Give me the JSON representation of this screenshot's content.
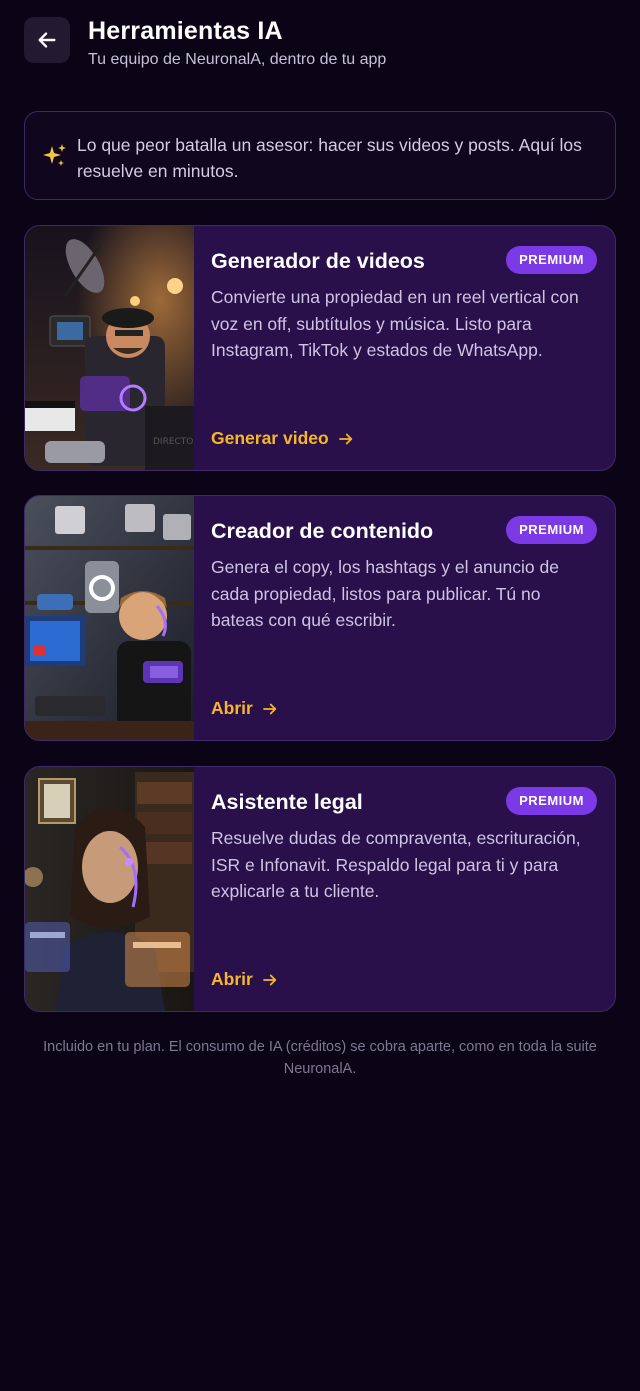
{
  "header": {
    "title": "Herramientas IA",
    "subtitle": "Tu equipo de NeuronalA, dentro de tu app",
    "back_icon": "arrow-left-icon"
  },
  "banner": {
    "icon": "sparkles-icon",
    "text": "Lo que peor batalla un asesor: hacer sus videos y posts. Aquí los resuelve en minutos."
  },
  "cards": [
    {
      "title": "Generador de videos",
      "badge": "PREMIUM",
      "description": "Convierte una propiedad en un reel vertical con voz en off, subtítulos y música. Listo para Instagram, TikTok y estados de WhatsApp.",
      "action": "Generar video",
      "image": "video-director-robot-illustration"
    },
    {
      "title": "Creador de contenido",
      "badge": "PREMIUM",
      "description": "Genera el copy, los hashtags y el anuncio de cada propiedad, listos para publicar. Tú no bateas con qué escribir.",
      "action": "Abrir",
      "image": "content-creator-robot-illustration"
    },
    {
      "title": "Asistente legal",
      "badge": "PREMIUM",
      "description": "Resuelve dudas de compraventa, escrituración, ISR e Infonavit. Respaldo legal para ti y para explicarle a tu cliente.",
      "action": "Abrir",
      "image": "legal-assistant-robot-illustration"
    }
  ],
  "footer": {
    "text": "Incluido en tu plan. El consumo de IA (créditos) se cobra aparte, como en toda la suite NeuronalA."
  },
  "colors": {
    "background": "#0b0416",
    "card": "#29104a",
    "badge": "#7b3ae6",
    "action": "#f5b62a",
    "sparkle": "#f5c542"
  }
}
